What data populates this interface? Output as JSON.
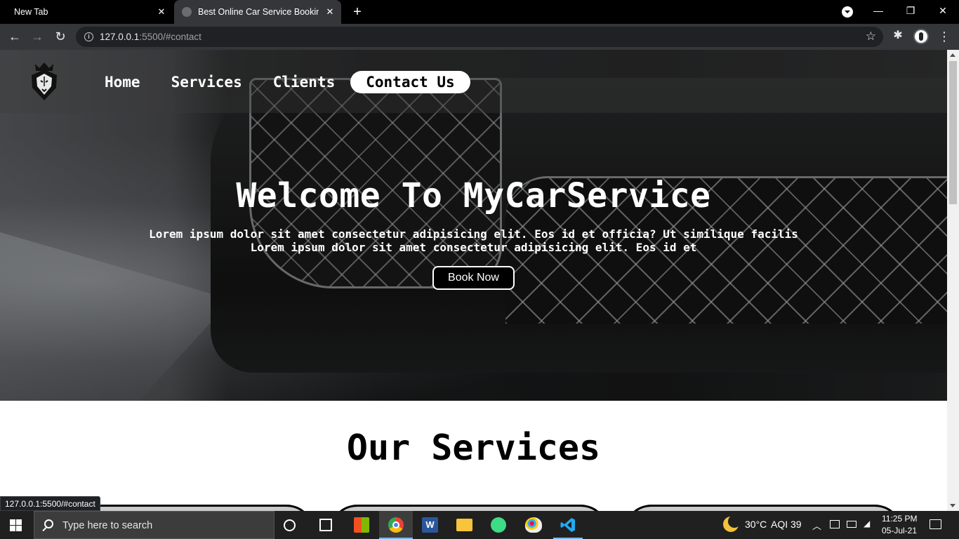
{
  "browser": {
    "tabs": [
      {
        "label": "New Tab"
      },
      {
        "label": "Best Online Car Service Booking |"
      }
    ],
    "url_host": "127.0.0.1",
    "url_rest": ":5500/#contact"
  },
  "site": {
    "nav": [
      "Home",
      "Services",
      "Clients",
      "Contact Us"
    ],
    "active_nav": "Contact Us",
    "hero_title": "Welcome To MyCarService",
    "hero_line1": "Lorem ipsum dolor sit amet consectetur adipisicing elit. Eos id et officia? Ut similique facilis",
    "hero_line2": "Lorem ipsum dolor sit amet consectetur adipisicing elit. Eos id et",
    "book_label": "Book Now",
    "services_title": "Our Services"
  },
  "status_url": "127.0.0.1:5500/#contact",
  "taskbar": {
    "search_placeholder": "Type here to search",
    "weather_temp": "30°C",
    "aqi": "AQI 39",
    "time": "11:25 PM",
    "date": "05-Jul-21"
  }
}
